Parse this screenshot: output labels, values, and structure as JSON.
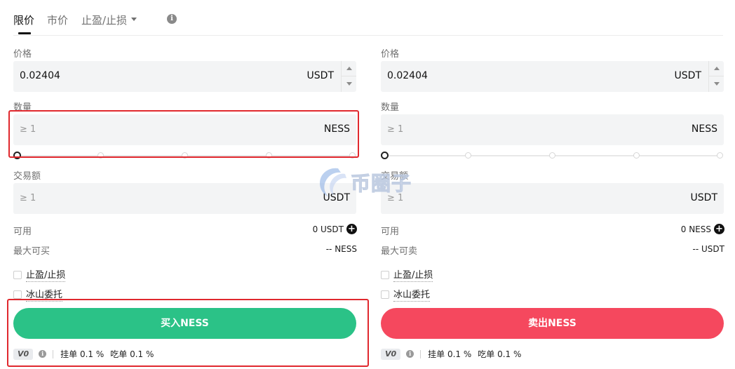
{
  "tabs": {
    "limit": "限价",
    "market": "市价",
    "stop": "止盈/止损"
  },
  "buy": {
    "price_label": "价格",
    "price_value": "0.02404",
    "price_unit": "USDT",
    "qty_label": "数量",
    "qty_placeholder": "≥ 1",
    "qty_unit": "NESS",
    "slider_level": 0,
    "amount_label": "交易额",
    "amount_placeholder": "≥ 1",
    "amount_unit": "USDT",
    "available_label": "可用",
    "available_value": "0 USDT",
    "max_label": "最大可买",
    "max_value": "-- NESS",
    "tp_sl_label": "止盈/止损",
    "iceberg_label": "冰山委托",
    "button_label": "买入NESS",
    "vip": "V0",
    "maker_fee": "挂单 0.1 %",
    "taker_fee": "吃单 0.1 %"
  },
  "sell": {
    "price_label": "价格",
    "price_value": "0.02404",
    "price_unit": "USDT",
    "qty_label": "数量",
    "qty_placeholder": "≥ 1",
    "qty_unit": "NESS",
    "slider_level": 0,
    "amount_label": "交易额",
    "amount_placeholder": "≥ 1",
    "amount_unit": "USDT",
    "available_label": "可用",
    "available_value": "0 NESS",
    "max_label": "最大可卖",
    "max_value": "-- USDT",
    "tp_sl_label": "止盈/止损",
    "iceberg_label": "冰山委托",
    "button_label": "卖出NESS",
    "vip": "V0",
    "maker_fee": "挂单 0.1 %",
    "taker_fee": "吃单 0.1 %"
  },
  "watermark": "币圈子",
  "colors": {
    "buy": "#2bc287",
    "sell": "#f5485e",
    "highlight": "#e0282e"
  }
}
